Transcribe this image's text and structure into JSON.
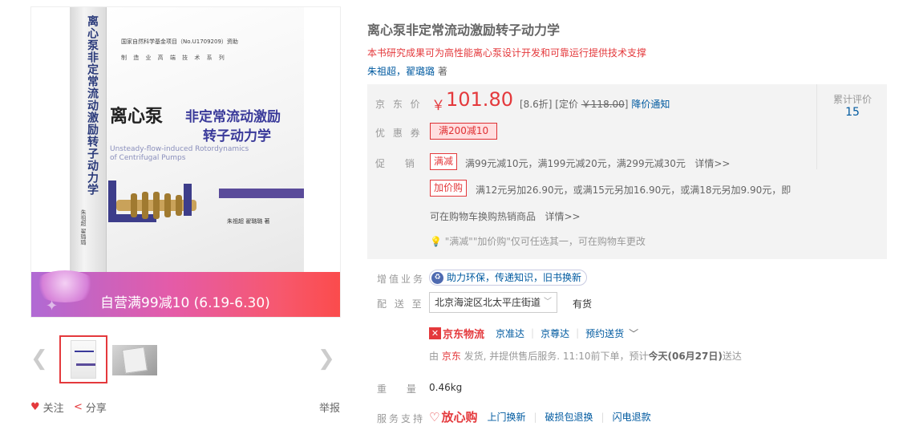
{
  "gallery": {
    "cover": {
      "spine_title": "离心泵非定常流动激励转子动力学",
      "spine_author": "朱祖超 翟璐璐",
      "fund_note": "国家自然科学基金项目（No.U1709209）资助",
      "series": "制 造 业 高 端 技 术 系 列",
      "title_part1": "离心泵",
      "title_part2": "非定常流动激励",
      "title_part3": "转子动力学",
      "english_line1": "Unsteady-flow-induced Rotordynamics",
      "english_line2": "of Centrifugal Pumps",
      "author_line": "朱祖超  翟璐璐  著"
    },
    "promo_banner": "自营满99减10 (6.19-6.30)",
    "actions": {
      "follow": "关注",
      "share": "分享",
      "report": "举报"
    }
  },
  "product": {
    "title": "离心泵非定常流动激励转子动力学",
    "subtitle": "本书研究成果可为高性能离心泵设计开发和可靠运行提供技术支撑",
    "authors": "朱祖超，翟璐璐",
    "author_suffix": " 著"
  },
  "summary": {
    "price_label": "京 东 价",
    "currency": "￥",
    "price": "101.80",
    "discount": "[8.6折]",
    "list_label": "[定价",
    "list_price": "￥118.00",
    "list_close": "]",
    "price_notice": "降价通知",
    "rating_label": "累计评价",
    "rating_count": "15",
    "coupon_label": "优 惠 券",
    "coupon": "满200减10",
    "promo_label": "促　 销",
    "promo1_tag": "满减",
    "promo1_text": "满99元减10元，满199元减20元，满299元减30元",
    "promo1_more": "详情>>",
    "promo2_tag": "加价购",
    "promo2_text": "满12元另加26.90元，或满15元另加16.90元，或满18元另加9.90元，即",
    "promo2_text2": "可在购物车换购热销商品",
    "promo2_more": "详情>>",
    "tip": "\"满减\"\"加价购\"仅可任选其一，可在购物车更改"
  },
  "vas": {
    "label": "增值业务",
    "pill": "助力环保，传递知识，旧书换新"
  },
  "delivery": {
    "label": "配 送 至",
    "address": "北京海淀区北太平庄街道",
    "stock": "有货",
    "logistics_brand": "京东物流",
    "options": [
      "京准达",
      "京尊达",
      "预约送货"
    ],
    "ship_prefix": "由 ",
    "ship_seller": "京东",
    "ship_mid": " 发货, 并提供售后服务. 11:10前下单，预计",
    "ship_date": "今天(06月27日)",
    "ship_suffix": "送达"
  },
  "weight": {
    "label": "重　 量",
    "value": "0.46kg"
  },
  "service": {
    "label": "服务支持",
    "brand": "放心购",
    "items": [
      "上门换新",
      "破损包退换",
      "闪电退款"
    ]
  },
  "colors": {
    "accent_red": "#e4393c",
    "link_blue": "#005aa0",
    "summary_bg": "#f3f3f3"
  }
}
